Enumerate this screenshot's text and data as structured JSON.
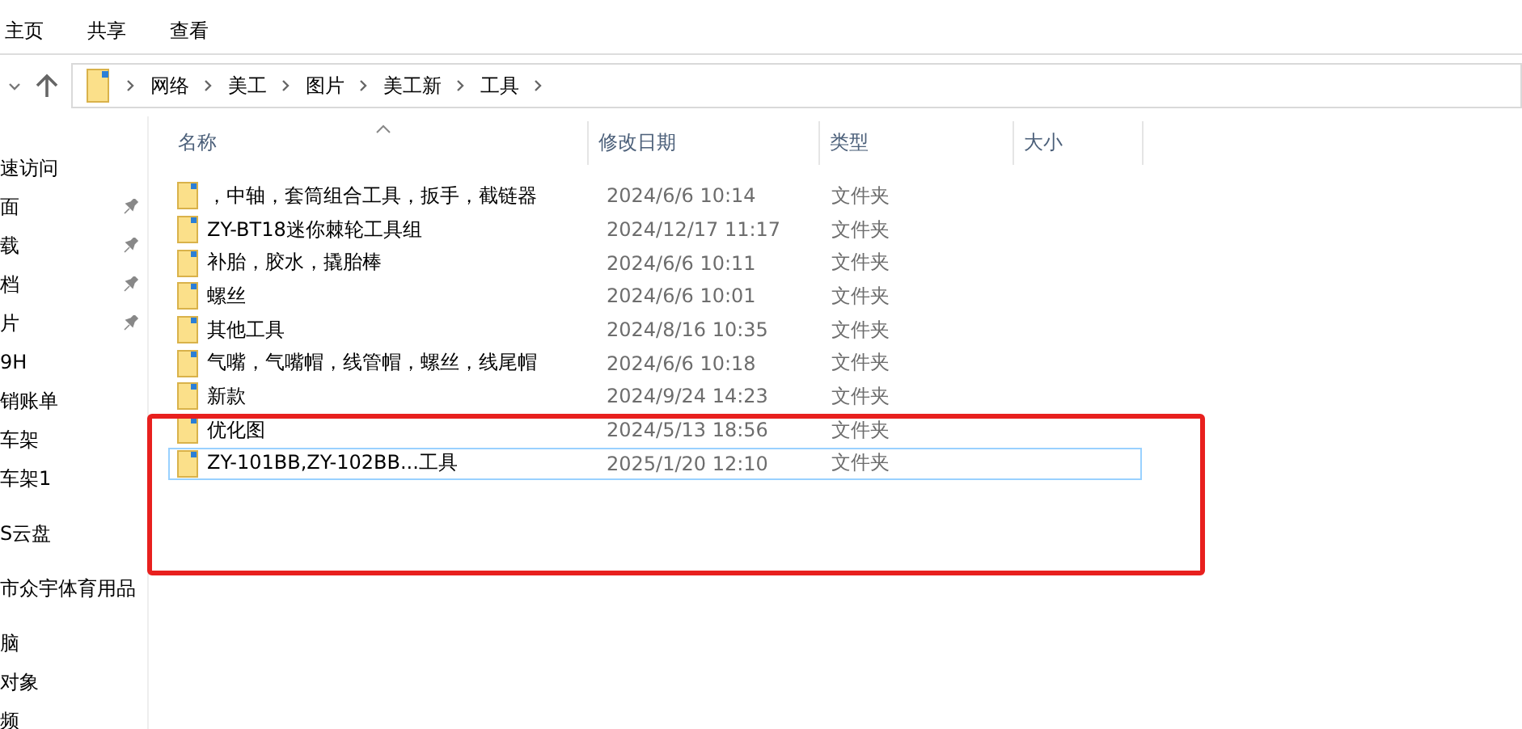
{
  "ribbon_tabs": [
    {
      "label": "主页"
    },
    {
      "label": "共享"
    },
    {
      "label": "查看"
    }
  ],
  "address_bar": {
    "path": [
      "网络",
      "美工",
      "图片",
      "美工新",
      "工具"
    ]
  },
  "sidebar": {
    "sections": [
      {
        "items": [
          {
            "label": "速访问",
            "pinned": false
          },
          {
            "label": "面",
            "pinned": true
          },
          {
            "label": "载",
            "pinned": true
          },
          {
            "label": "档",
            "pinned": true
          },
          {
            "label": "片",
            "pinned": true
          },
          {
            "label": "9H",
            "pinned": false
          },
          {
            "label": "销账单",
            "pinned": false
          },
          {
            "label": "车架",
            "pinned": false
          },
          {
            "label": "车架1",
            "pinned": false
          }
        ]
      },
      {
        "items": [
          {
            "label": "S云盘",
            "pinned": false
          }
        ]
      },
      {
        "items": [
          {
            "label": "市众宇体育用品",
            "pinned": false
          }
        ]
      },
      {
        "items": [
          {
            "label": "脑",
            "pinned": false
          },
          {
            "label": "对象",
            "pinned": false
          },
          {
            "label": "频",
            "pinned": false
          }
        ]
      }
    ]
  },
  "table": {
    "columns": [
      "名称",
      "修改日期",
      "类型",
      "大小"
    ],
    "rows": [
      {
        "name": "，中轴，套筒组合工具，扳手，截链器",
        "date": "2024/6/6 10:14",
        "type": "文件夹",
        "selected": false
      },
      {
        "name": "ZY-BT18迷你棘轮工具组",
        "date": "2024/12/17 11:17",
        "type": "文件夹",
        "selected": false
      },
      {
        "name": "补胎，胶水，撬胎棒",
        "date": "2024/6/6 10:11",
        "type": "文件夹",
        "selected": false
      },
      {
        "name": "螺丝",
        "date": "2024/6/6 10:01",
        "type": "文件夹",
        "selected": false
      },
      {
        "name": "其他工具",
        "date": "2024/8/16 10:35",
        "type": "文件夹",
        "selected": false
      },
      {
        "name": "气嘴，气嘴帽，线管帽，螺丝，线尾帽",
        "date": "2024/6/6 10:18",
        "type": "文件夹",
        "selected": false
      },
      {
        "name": "新款",
        "date": "2024/9/24 14:23",
        "type": "文件夹",
        "selected": false
      },
      {
        "name": "优化图",
        "date": "2024/5/13 18:56",
        "type": "文件夹",
        "selected": false
      },
      {
        "name": "ZY-101BB,ZY-102BB...工具",
        "date": "2025/1/20 12:10",
        "type": "文件夹",
        "selected": true
      }
    ]
  }
}
